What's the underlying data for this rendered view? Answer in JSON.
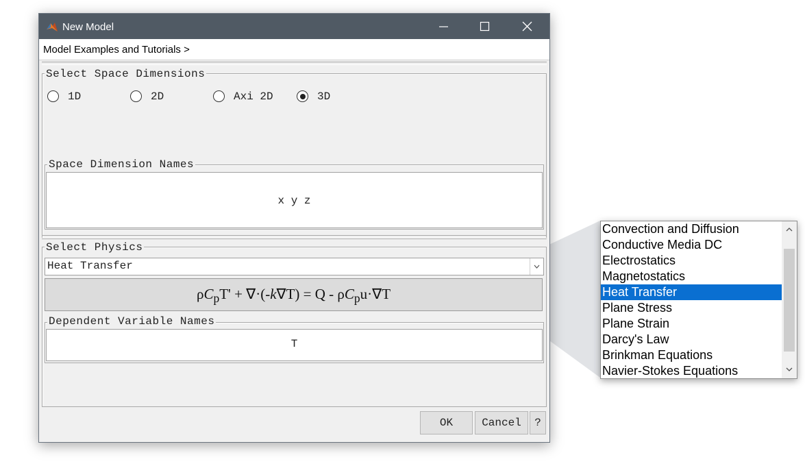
{
  "window": {
    "title": "New Model",
    "menu_label": "Model Examples and Tutorials >"
  },
  "space_dimensions": {
    "legend": "Select Space Dimensions",
    "options": [
      "1D",
      "2D",
      "Axi 2D",
      "3D"
    ],
    "selected": "3D"
  },
  "space_names": {
    "legend": "Space Dimension Names",
    "value": "x y z"
  },
  "physics": {
    "legend": "Select Physics",
    "selected": "Heat Transfer",
    "equation": {
      "p1": "ρ",
      "c1": "C",
      "s1": "p",
      "p2": "T' + ∇·(-",
      "k": "k",
      "p3": "∇T) = Q - ρ",
      "c2": "C",
      "s2": "p",
      "p4": "u·∇T"
    }
  },
  "dependent_vars": {
    "legend": "Dependent Variable Names",
    "value": "T"
  },
  "buttons": {
    "ok": "OK",
    "cancel": "Cancel",
    "help": "?"
  },
  "physics_list": {
    "items": [
      "Convection and Diffusion",
      "Conductive Media DC",
      "Electrostatics",
      "Magnetostatics",
      "Heat Transfer",
      "Plane Stress",
      "Plane Strain",
      "Darcy's Law",
      "Brinkman Equations",
      "Navier-Stokes Equations"
    ],
    "selected_index": 4
  },
  "colors": {
    "titlebar": "#505a64",
    "selection": "#0a6fd1"
  }
}
